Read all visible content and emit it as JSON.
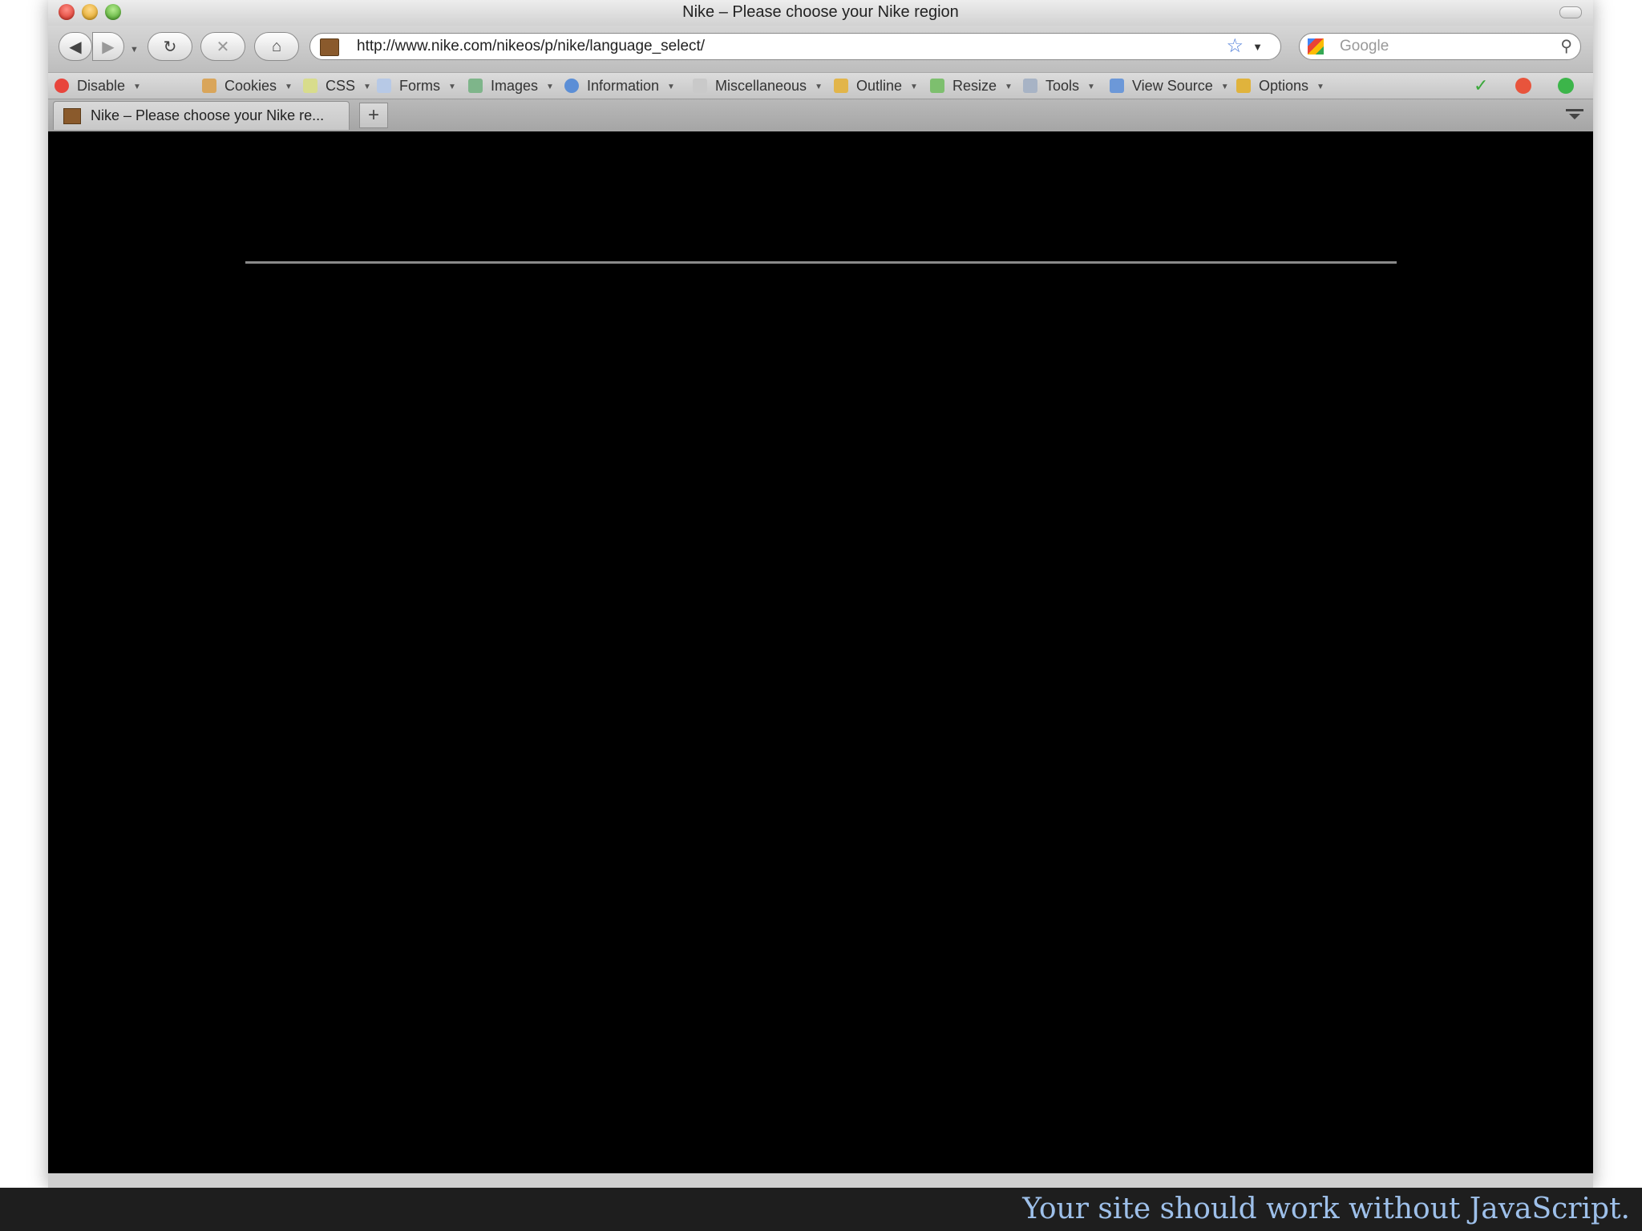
{
  "window": {
    "title": "Nike – Please choose your Nike region"
  },
  "nav": {
    "url": "http://www.nike.com/nikeos/p/nike/language_select/",
    "search_placeholder": "Google"
  },
  "toolbar": {
    "items": [
      {
        "label": "Disable",
        "icon": "disable-icon"
      },
      {
        "label": "Cookies",
        "icon": "cookies-icon"
      },
      {
        "label": "CSS",
        "icon": "css-icon"
      },
      {
        "label": "Forms",
        "icon": "forms-icon"
      },
      {
        "label": "Images",
        "icon": "images-icon"
      },
      {
        "label": "Information",
        "icon": "information-icon"
      },
      {
        "label": "Miscellaneous",
        "icon": "miscellaneous-icon"
      },
      {
        "label": "Outline",
        "icon": "outline-icon"
      },
      {
        "label": "Resize",
        "icon": "resize-icon"
      },
      {
        "label": "Tools",
        "icon": "tools-icon"
      },
      {
        "label": "View Source",
        "icon": "view-source-icon"
      },
      {
        "label": "Options",
        "icon": "options-icon"
      }
    ]
  },
  "tab": {
    "title": "Nike – Please choose your Nike re...",
    "new_tab": "+"
  },
  "caption": "Your site should work without JavaScript."
}
